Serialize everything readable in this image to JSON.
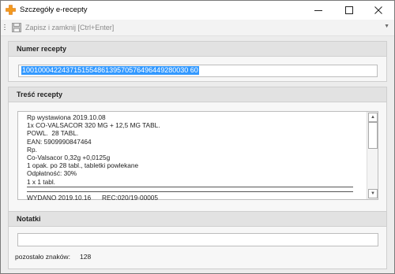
{
  "window": {
    "title": "Szczegóły e-recepty"
  },
  "toolbar": {
    "save_label": "Zapisz i zamknij [Ctrl+Enter]"
  },
  "prescription_number": {
    "header": "Numer recepty",
    "value": "100100042243715155486139570576496449280030 60"
  },
  "prescription_content": {
    "header": "Treść recepty",
    "lines": [
      "Rp wystawiona 2019.10.08",
      "1x CO-VALSACOR 320 MG + 12,5 MG TABL.",
      "POWL.  28 TABL.",
      "EAN: 5909990847464",
      "Rp.",
      "Co-Valsacor 0,32g +0,0125g",
      "1 opak. po 28 tabl., tabletki powlekane",
      "Odpłatność: 30%",
      "1 x 1 tabl."
    ],
    "issued_line": "WYDANO 2019.10.16      REC:020/19-00005"
  },
  "notes": {
    "header": "Notatki",
    "value": "",
    "remaining_label": "pozostało znaków:",
    "remaining_count": "128"
  }
}
